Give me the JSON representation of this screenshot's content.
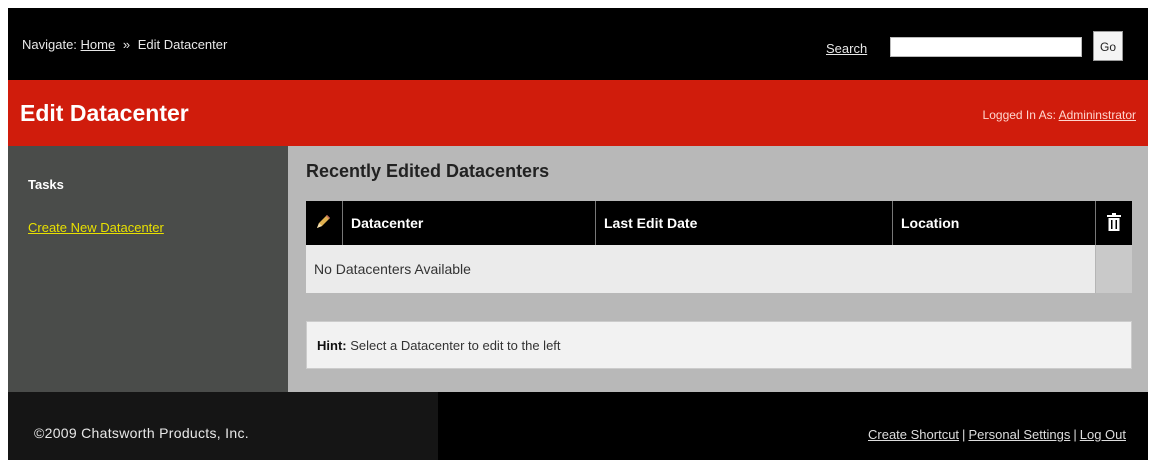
{
  "header": {
    "navigate_label": "Navigate:",
    "home_link": "Home",
    "separator": "»",
    "current_page": "Edit Datacenter",
    "search_label": "Search",
    "search_value": "",
    "go_label": "Go"
  },
  "titlebar": {
    "title": "Edit Datacenter",
    "logged_in_label": "Logged In As:",
    "user": "Admininstrator"
  },
  "sidebar": {
    "heading": "Tasks",
    "task_link": "Create New Datacenter"
  },
  "main": {
    "title": "Recently Edited Datacenters",
    "columns": [
      "Datacenter",
      "Last Edit Date",
      "Location"
    ],
    "empty_message": "No Datacenters Available",
    "hint_label": "Hint:",
    "hint_text": "Select a Datacenter to edit to the left"
  },
  "footer": {
    "copyright": "©2009 Chatsworth Products, Inc.",
    "links": [
      "Create Shortcut",
      "Personal Settings",
      "Log Out"
    ],
    "separator": "|"
  },
  "icons": {
    "edit": "pencil-icon",
    "delete": "trash-icon"
  },
  "colors": {
    "accent": "#d01c0c",
    "header_bg": "#000000",
    "sidebar_bg": "#4a4c4a",
    "content_bg": "#b8b8b8",
    "task_link": "#e8e000"
  }
}
